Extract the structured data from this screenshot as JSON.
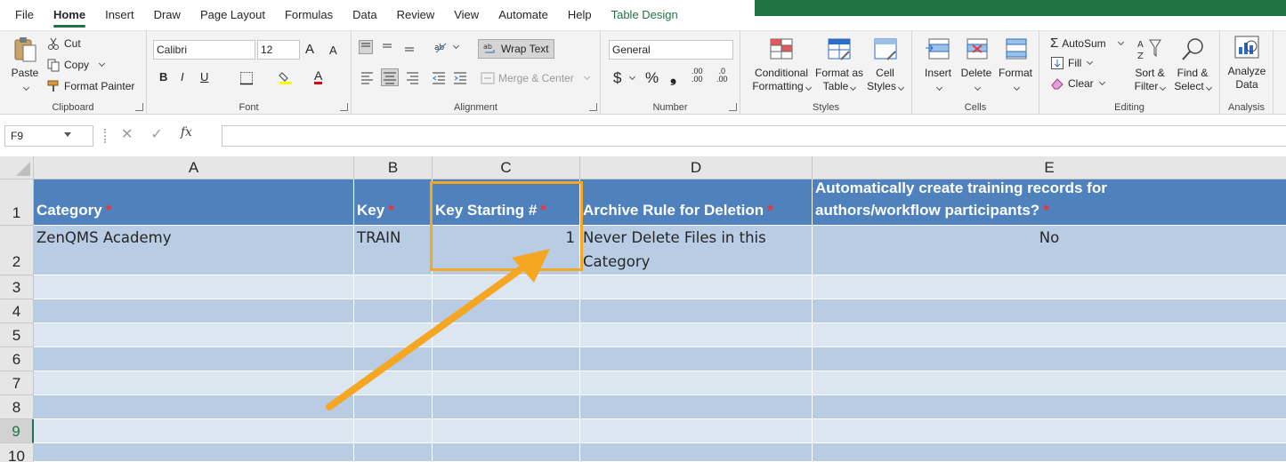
{
  "tabs": [
    "File",
    "Home",
    "Insert",
    "Draw",
    "Page Layout",
    "Formulas",
    "Data",
    "Review",
    "View",
    "Automate",
    "Help",
    "Table Design"
  ],
  "clipboard": {
    "paste": "Paste",
    "cut": "Cut",
    "copy": "Copy",
    "format_painter": "Format Painter",
    "label": "Clipboard"
  },
  "font": {
    "name": "Calibri",
    "size": "12",
    "grow": "A",
    "shrink": "A",
    "bold": "B",
    "italic": "I",
    "underline": "U",
    "font_color": "A",
    "label": "Font"
  },
  "alignment": {
    "wrap_text": "Wrap Text",
    "merge_center": "Merge & Center",
    "label": "Alignment"
  },
  "number": {
    "format": "General",
    "currency": "$",
    "percent": "%",
    "comma": "❟",
    "inc_decimal": ".00",
    "dec_decimal": ".0",
    "label": "Number"
  },
  "styles": {
    "conditional": [
      "Conditional",
      "Formatting"
    ],
    "format_table": [
      "Format as",
      "Table"
    ],
    "cell_styles": [
      "Cell",
      "Styles"
    ],
    "label": "Styles"
  },
  "cells": {
    "insert": "Insert",
    "delete": "Delete",
    "format": "Format",
    "label": "Cells"
  },
  "editing": {
    "autosum": "AutoSum",
    "fill": "Fill",
    "clear": "Clear",
    "sort": [
      "Sort &",
      "Filter"
    ],
    "find": [
      "Find &",
      "Select"
    ],
    "label": "Editing"
  },
  "analysis": {
    "analyze": [
      "Analyze",
      "Data"
    ],
    "label": "Analysis"
  },
  "formula_bar": {
    "name_box": "F9",
    "cancel": "✕",
    "enter": "✓",
    "fx": "fx",
    "value": ""
  },
  "columns": [
    "A",
    "B",
    "C",
    "D",
    "E"
  ],
  "rows": [
    "1",
    "2",
    "3",
    "4",
    "5",
    "6",
    "7",
    "8",
    "9",
    "10"
  ],
  "selected_row": "9",
  "headers": {
    "a": "Category",
    "b": "Key",
    "c": "Key Starting #",
    "d": "Archive Rule for Deletion",
    "e1": "Automatically create training records for",
    "e2": "authors/workflow participants?",
    "required_mark": "*"
  },
  "row2": {
    "a": "ZenQMS Academy",
    "b": "TRAIN",
    "c": "1",
    "d1": "Never Delete Files in this",
    "d2": "Category",
    "e": "No"
  },
  "colors": {
    "accent": "#217346",
    "header_fill": "#4f81bd",
    "band_dark": "#b8cce4",
    "band_light": "#dce6f1",
    "callout": "#f5a623"
  }
}
